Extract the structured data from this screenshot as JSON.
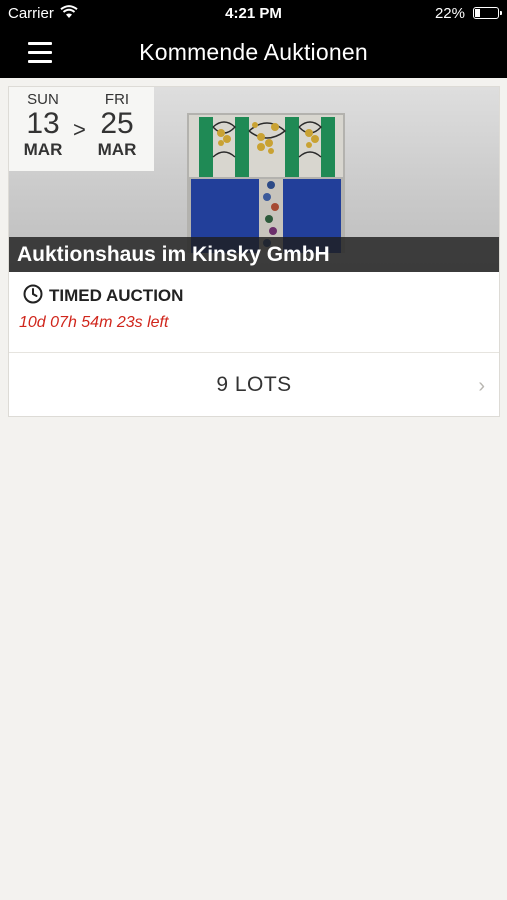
{
  "status_bar": {
    "carrier": "Carrier",
    "wifi_icon": "wifi-icon",
    "time": "4:21 PM",
    "battery_percent": "22%",
    "battery_level": 0.22
  },
  "nav": {
    "menu_icon": "hamburger-icon",
    "title": "Kommende Auktionen"
  },
  "auction": {
    "start": {
      "dow": "SUN",
      "day": "13",
      "month": "MAR"
    },
    "separator": ">",
    "end": {
      "dow": "FRI",
      "day": "25",
      "month": "MAR"
    },
    "house": "Auktionshaus im Kinsky GmbH",
    "type_icon": "clock-icon",
    "type": "TIMED AUCTION",
    "time_left": "10d 07h 54m 23s left",
    "time_left_color": "#d0261c",
    "lots": "9 LOTS",
    "chevron": "›"
  }
}
